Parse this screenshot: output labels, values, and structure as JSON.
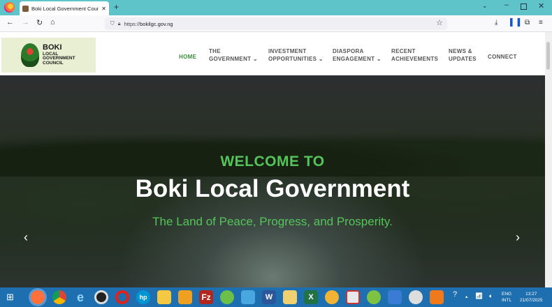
{
  "browser": {
    "tab_title": "Boki Local Government Counc",
    "tab_close": "✕",
    "new_tab": "+",
    "url_prefix": "https://",
    "url_host": "bokilgc",
    "url_rest": ".gov.ng"
  },
  "site": {
    "logo_line1": "BOKI",
    "logo_line2": "LOCAL",
    "logo_line3": "GOVERNMENT",
    "logo_line4": "COUNCIL",
    "nav": [
      {
        "label1": "HOME",
        "label2": ""
      },
      {
        "label1": "THE",
        "label2": "GOVERNMENT ⌄"
      },
      {
        "label1": "INVESTMENT",
        "label2": "OPPORTUNITIES ⌄"
      },
      {
        "label1": "DIASPORA",
        "label2": "ENGAGEMENT ⌄"
      },
      {
        "label1": "RECENT",
        "label2": "ACHIEVEMENTS"
      },
      {
        "label1": "NEWS &",
        "label2": "UPDATES"
      },
      {
        "label1": "CONNECT",
        "label2": ""
      }
    ]
  },
  "hero": {
    "welcome": "WELCOME TO",
    "title": "Boki Local Government",
    "subtitle": "The Land of Peace, Progress, and Prosperity.",
    "prev": "‹",
    "next": "›"
  },
  "taskbar": {
    "lang1": "ENG",
    "lang2": "INTL",
    "time": "13:27",
    "date": "21/07/2025"
  },
  "colors": {
    "accent_green": "#55c45a",
    "tab_bar": "#5ec4c9",
    "taskbar": "#1e6fb0"
  }
}
